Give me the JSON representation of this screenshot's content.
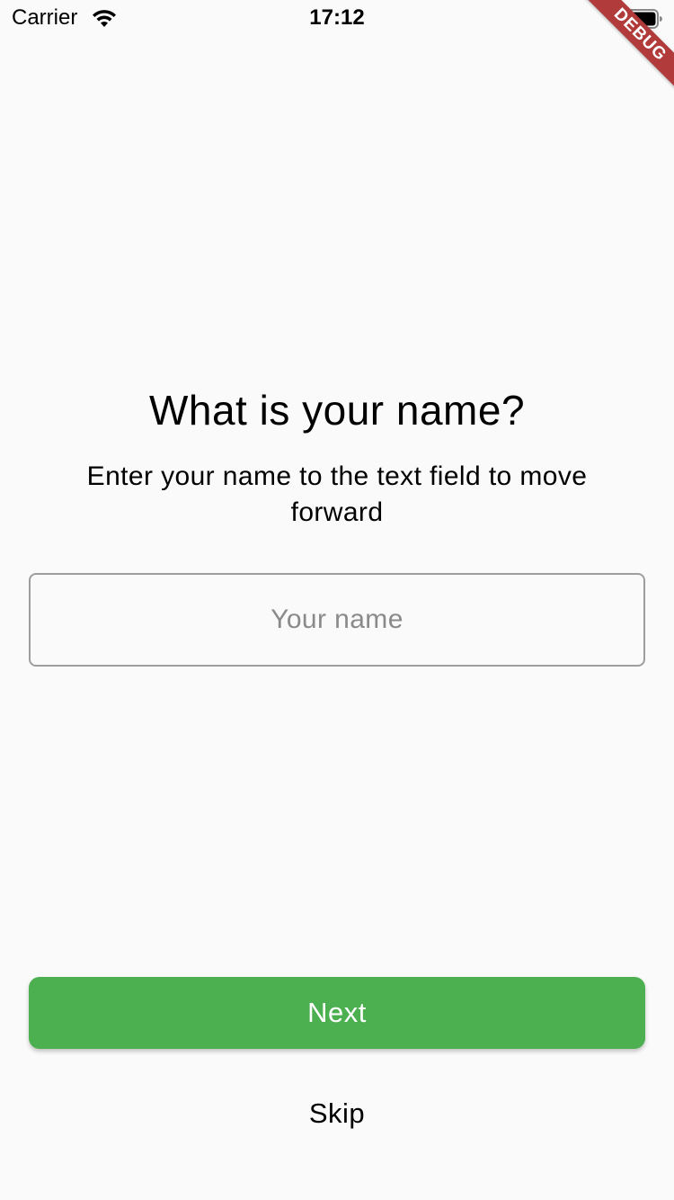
{
  "status_bar": {
    "carrier": "Carrier",
    "time": "17:12",
    "icons": [
      "wifi-icon",
      "battery-icon"
    ]
  },
  "debug_banner": {
    "label": "DEBUG",
    "color": "#b13b3b"
  },
  "main": {
    "title": "What is your name?",
    "subtitle": "Enter your name to the text field to move forward",
    "name_input": {
      "value": "",
      "placeholder": "Your name"
    }
  },
  "actions": {
    "next_label": "Next",
    "skip_label": "Skip",
    "accent_color": "#4caf50"
  }
}
